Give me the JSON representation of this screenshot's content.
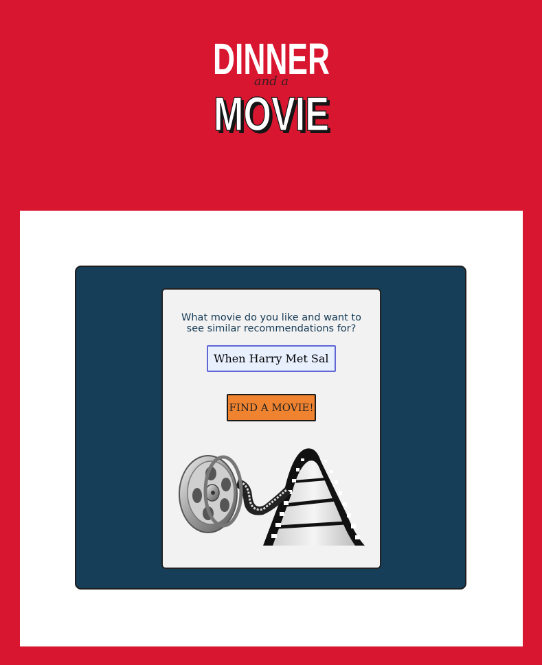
{
  "brand": {
    "logo_text": "DINNER and a MOVIE"
  },
  "search": {
    "question": "What movie do you like and want to see similar recommendations for?",
    "value": "When Harry Met Sally",
    "button_label": "FIND A MOVIE!"
  },
  "colors": {
    "brand_red": "#d91630",
    "navy": "#163e59",
    "card": "#f2f2f2",
    "button": "#f0832f",
    "input_bg": "#e8f0fe",
    "input_border": "#6066d6"
  },
  "icons": {
    "logo": "dinner-and-a-movie-logo",
    "illustration": "film-reel-icon"
  }
}
